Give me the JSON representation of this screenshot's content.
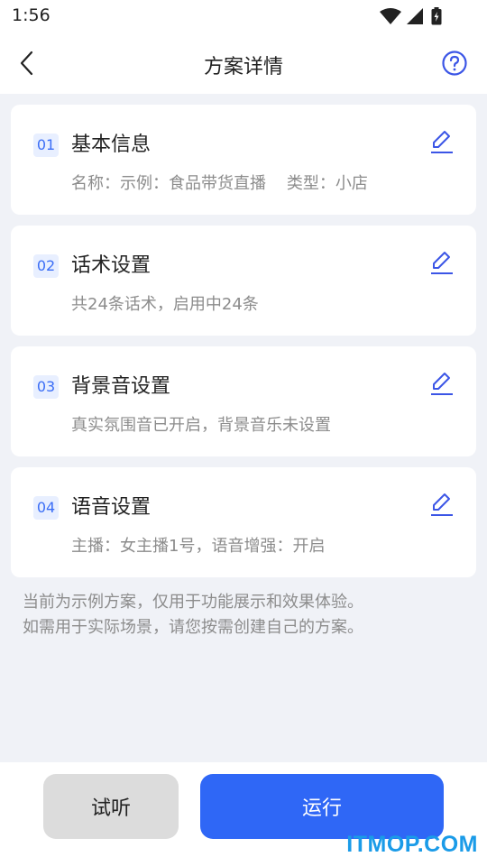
{
  "status_bar": {
    "time": "1:56",
    "icons": [
      "wifi-icon",
      "signal-icon",
      "battery-icon"
    ]
  },
  "header": {
    "title": "方案详情",
    "back_icon": "chevron-left-icon",
    "help_icon": "question-circle-icon"
  },
  "cards": [
    {
      "number": "01",
      "title": "基本信息",
      "desc": "名称：示例：食品带货直播    类型：小店",
      "edit_icon": "pencil-icon"
    },
    {
      "number": "02",
      "title": "话术设置",
      "desc": "共24条话术，启用中24条",
      "edit_icon": "pencil-icon"
    },
    {
      "number": "03",
      "title": "背景音设置",
      "desc": "真实氛围音已开启，背景音乐未设置",
      "edit_icon": "pencil-icon"
    },
    {
      "number": "04",
      "title": "语音设置",
      "desc": "主播：女主播1号，语音增强：开启",
      "edit_icon": "pencil-icon"
    }
  ],
  "note": {
    "line1": "当前为示例方案，仅用于功能展示和效果体验。",
    "line2": "如需用于实际场景，请您按需创建自己的方案。"
  },
  "footer": {
    "listen_label": "试听",
    "run_label": "运行",
    "watermark": "ITMOP.COM"
  },
  "colors": {
    "accent": "#2f67f6",
    "badge_bg": "#e8efff",
    "page_bg": "#f0f2f7",
    "secondary_text": "#8c8c8c",
    "watermark": "#1a9be8"
  }
}
